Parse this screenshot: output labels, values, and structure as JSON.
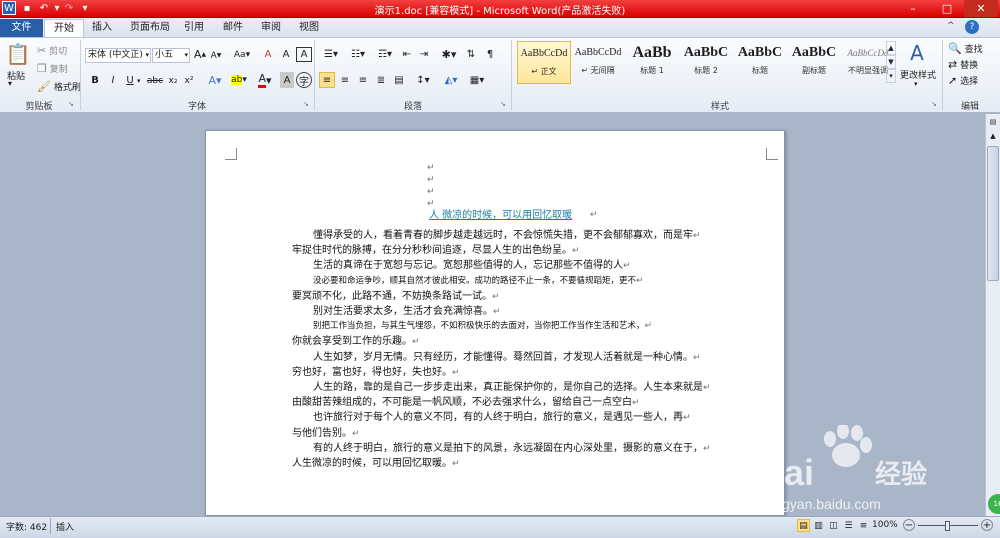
{
  "window": {
    "title": "演示1.doc [兼容模式] - Microsoft Word(产品激活失败)",
    "minimize": "–",
    "maximize": "□",
    "close": "✕"
  },
  "tabs": [
    "文件",
    "开始",
    "插入",
    "页面布局",
    "引用",
    "邮件",
    "审阅",
    "视图"
  ],
  "ribbon": {
    "clipboard": {
      "paste": "粘贴",
      "cut": "剪切",
      "copy": "复制",
      "format_painter": "格式刷",
      "label": "剪贴板"
    },
    "font": {
      "name": "宋体 (中文正)",
      "size": "小五",
      "label": "字体",
      "bold": "B",
      "italic": "I",
      "underline": "U",
      "strike": "abc",
      "sub": "x₂",
      "sup": "x²",
      "grow": "A",
      "shrink": "A",
      "case": "Aa",
      "clear": "A",
      "font_color": "A",
      "highlight": "ab",
      "char_border": "A",
      "phonetic": "A"
    },
    "paragraph": {
      "label": "段落"
    },
    "styles": {
      "label": "样式",
      "items": [
        {
          "preview": "AaBbCcDd",
          "name": "↵ 正文"
        },
        {
          "preview": "AaBbCcDd",
          "name": "↵ 无间隔"
        },
        {
          "preview": "AaBb",
          "name": "标题 1"
        },
        {
          "preview": "AaBbC",
          "name": "标题 2"
        },
        {
          "preview": "AaBbC",
          "name": "标题"
        },
        {
          "preview": "AaBbC",
          "name": "副标题"
        },
        {
          "preview": "AaBbCcDd",
          "name": "不明显强调"
        }
      ],
      "change_styles": "更改样式"
    },
    "editing": {
      "find": "查找",
      "replace": "替换",
      "select": "选择",
      "label": "编辑"
    }
  },
  "document": {
    "heading": "人  微凉的时候，可以用回忆取暖",
    "lines": [
      {
        "text": "懂得承受的人，看着青春的脚步越走越远时，不会惊慌失措，更不会郁郁寡欢，而是牢",
        "indent": true,
        "small": false
      },
      {
        "text": "牢捉住时代的脉搏，在分分秒秒间追逐，尽显人生的出色纷呈。",
        "indent": false,
        "small": false
      },
      {
        "text": "生活的真谛在于宽恕与忘记。宽恕那些值得的人，忘记那些不值得的人",
        "indent": true,
        "small": false
      },
      {
        "text": "没必要和命运争吵，顺其自然才彼此相安。成功的路径不止一条，不要循规蹈矩，更不",
        "indent": true,
        "small": true
      },
      {
        "text": "要冥顽不化，此路不通，不妨换条路试一试。",
        "indent": false,
        "small": false
      },
      {
        "text": "别对生活要求太多，生活才会充满惊喜。",
        "indent": true,
        "small": false
      },
      {
        "text": "别把工作当负担，与其生气埋怨，不如积极快乐的去面对，当你把工作当作生活和艺术，",
        "indent": true,
        "small": true
      },
      {
        "text": "你就会享受到工作的乐趣。",
        "indent": false,
        "small": false
      },
      {
        "text": "人生如梦，岁月无情。只有经历，才能懂得。蓦然回首，才发现人活着就是一种心情。",
        "indent": true,
        "small": false
      },
      {
        "text": "穷也好，富也好，得也好，失也好。",
        "indent": false,
        "small": false
      },
      {
        "text": "人生的路，靠的是自己一步步走出来，真正能保护你的，是你自己的选择。人生本来就是",
        "indent": true,
        "small": false
      },
      {
        "text": "由酸甜苦辣组成的，不可能是一帆风顺，不必去强求什么，留给自己一点空白",
        "indent": false,
        "small": false
      },
      {
        "text": " 也许旅行对于每个人的意义不同，有的人终于明白，旅行的意义，是遇见一些人，再",
        "indent": true,
        "small": false
      },
      {
        "text": "与他们告别。",
        "indent": false,
        "small": false
      },
      {
        "text": "有的人终于明白，旅行的意义是拍下的风景，永远凝固在内心深处里，摄影的意义在于，",
        "indent": true,
        "small": false
      },
      {
        "text": "人生微凉的时候，可以用回忆取暖。",
        "indent": false,
        "small": false
      }
    ],
    "paragraph_mark": "↵"
  },
  "status": {
    "words": "字数: 462",
    "insert": "插入",
    "zoom": "100%",
    "zoom_minus": "−",
    "zoom_plus": "+"
  },
  "watermark": {
    "brand_a": "Bai",
    "brand_b": "du",
    "brand_c": "经验",
    "url": "jingyan.baidu.com"
  },
  "colors": {
    "titlebar": "#e60000",
    "file_tab": "#2a5da8",
    "heading": "#1a7fa8"
  }
}
